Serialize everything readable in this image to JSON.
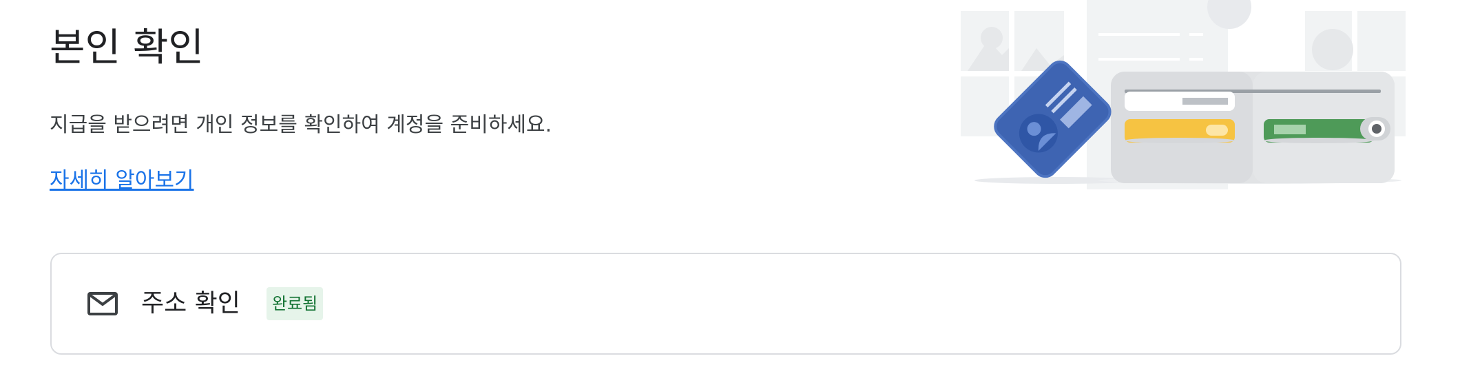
{
  "header": {
    "title": "본인 확인",
    "description": "지급을 받으려면 개인 정보를 확인하여 계정을 준비하세요.",
    "learn_more": "자세히 알아보기"
  },
  "illustration": {
    "icon": "id-card-and-wallet-illustration"
  },
  "verification_items": [
    {
      "icon": "mail-icon",
      "title": "주소 확인",
      "status": "완료됨",
      "status_color": "#137333",
      "status_bg": "#e6f4ea"
    }
  ],
  "colors": {
    "link": "#1a73e8",
    "card_border": "#dadce0"
  }
}
